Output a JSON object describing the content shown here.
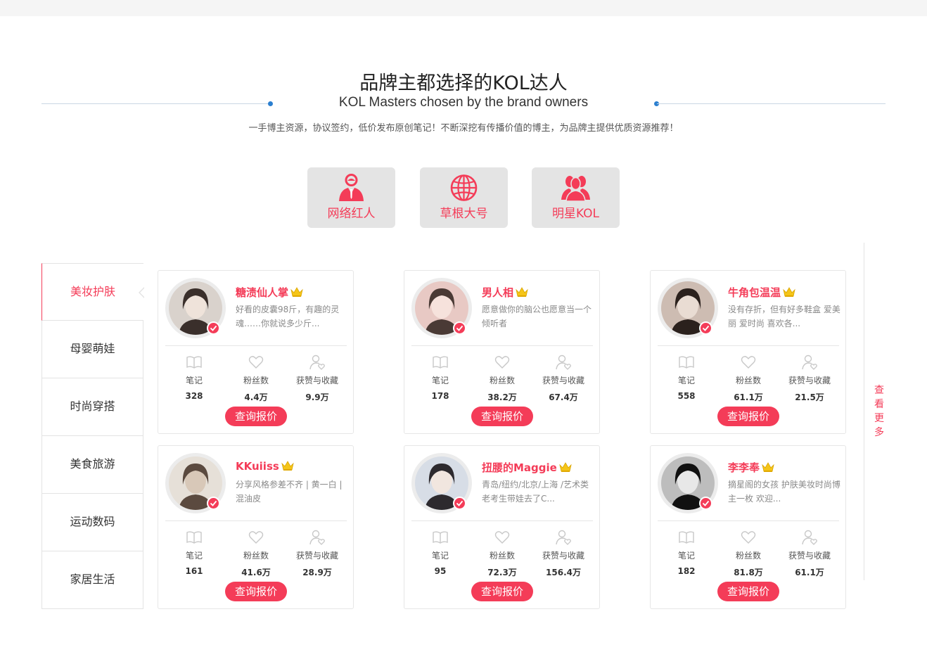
{
  "header": {
    "title": "品牌主都选择的KOL达人",
    "subtitle": "KOL Masters chosen by the brand owners",
    "tagline": "一手博主资源，协议签约，低价发布原创笔记！不断深挖有传播价值的博主，为品牌主提供优质资源推荐！"
  },
  "kol_types": [
    {
      "label": "网络红人",
      "icon": "person-icon"
    },
    {
      "label": "草根大号",
      "icon": "globe-icon"
    },
    {
      "label": "明星KOL",
      "icon": "group-icon"
    }
  ],
  "categories": [
    {
      "label": "美妆护肤",
      "active": true
    },
    {
      "label": "母婴萌娃",
      "active": false
    },
    {
      "label": "时尚穿搭",
      "active": false
    },
    {
      "label": "美食旅游",
      "active": false
    },
    {
      "label": "运动数码",
      "active": false
    },
    {
      "label": "家居生活",
      "active": false
    }
  ],
  "stat_labels": {
    "notes": "笔记",
    "fans": "粉丝数",
    "likes": "获赞与收藏"
  },
  "quote_label": "查询报价",
  "more_label": "查看更多",
  "kols": [
    {
      "name": "糖渍仙人掌",
      "desc": "好看的皮囊98斤，有趣的灵魂……你就说多少斤...",
      "notes": "328",
      "fans": "4.4万",
      "likes": "9.9万"
    },
    {
      "name": "男人相",
      "desc": "愿意做你的脑公也愿意当一个倾听者",
      "notes": "178",
      "fans": "38.2万",
      "likes": "67.4万"
    },
    {
      "name": "牛角包温温",
      "desc": "没有存折，但有好多鞋盒 爱美丽 爱时尚 喜欢各...",
      "notes": "558",
      "fans": "61.1万",
      "likes": "21.5万"
    },
    {
      "name": "KKuiiss",
      "desc": "分享风格参差不齐 | 黄一白 | 混油皮",
      "notes": "161",
      "fans": "41.6万",
      "likes": "28.9万"
    },
    {
      "name": "扭腰的Maggie",
      "desc": "青岛/纽约/北京/上海 /艺术类老考生带娃去了C...",
      "notes": "95",
      "fans": "72.3万",
      "likes": "156.4万"
    },
    {
      "name": "李李奉",
      "desc": "摘星阁的女孩 护肤美妆时尚博主一枚 欢迎...",
      "notes": "182",
      "fans": "81.8万",
      "likes": "61.1万"
    }
  ],
  "colors": {
    "accent": "#f43c58",
    "divider_dot": "#2b7fd0",
    "button_bg": "#e4e4e4"
  }
}
